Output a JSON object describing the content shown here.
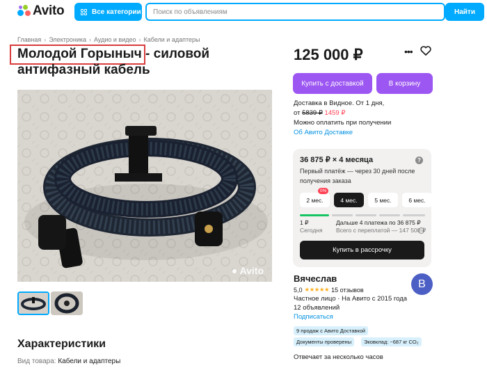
{
  "header": {
    "logo_text": "Avito",
    "categories_label": "Все категории",
    "search_placeholder": "Поиск по объявлениям",
    "search_button": "Найти"
  },
  "breadcrumb": [
    "Главная",
    "Электроника",
    "Аудио и видео",
    "Кабели и адаптеры"
  ],
  "title": {
    "highlighted": "Молодой Горыныч",
    "rest": " - силовой антифазный кабель"
  },
  "photo": {
    "watermark": "Avito"
  },
  "characteristics": {
    "heading": "Характеристики",
    "rows": [
      {
        "label": "Вид товара:",
        "value": "Кабели и адаптеры"
      }
    ]
  },
  "offer": {
    "price": "125 000 ₽",
    "buy_delivery_label": "Купить с доставкой",
    "cart_label": "В корзину",
    "delivery_line1": "Доставка в Видное. От 1 дня,",
    "delivery_from": "от",
    "delivery_old_price": "5839 ₽",
    "delivery_new_price": "1459 ₽",
    "delivery_line3": "Можно оплатить при получении",
    "delivery_link": "Об Авито Доставке"
  },
  "credit": {
    "title": "36 875 ₽ × 4 месяца",
    "desc": "Первый платёж — через 30 дней после получения заказа",
    "months": [
      {
        "label": "2 мес.",
        "badge": "0%",
        "active": false
      },
      {
        "label": "4 мес.",
        "badge": "",
        "active": true
      },
      {
        "label": "5 мес.",
        "badge": "",
        "active": false
      },
      {
        "label": "6 мес.",
        "badge": "",
        "active": false
      }
    ],
    "first_amount": "1 ₽",
    "first_when": "Сегодня",
    "rest_text": "Дальше 4 платежа по 36 875 ₽",
    "rest_total": "Всего с переплатой — 147 500 ₽",
    "button": "Купить в рассрочку"
  },
  "seller": {
    "name": "Вячеслав",
    "avatar_letter": "В",
    "rating": "5,0",
    "stars": "★★★★★",
    "reviews": "15 отзывов",
    "type_line": "Частное лицо · На Авито с 2015 года",
    "ads": "12 объявлений",
    "subscribe": "Подписаться",
    "chips": [
      "9 продаж с Авито Доставкой",
      "Документы проверены",
      "Эковклад: ~687 кг CO₂"
    ],
    "reply": "Отвечает за несколько часов"
  },
  "colors": {
    "accent_blue": "#00aaff",
    "purple": "#9c56f2",
    "price_red": "#ff4053"
  }
}
